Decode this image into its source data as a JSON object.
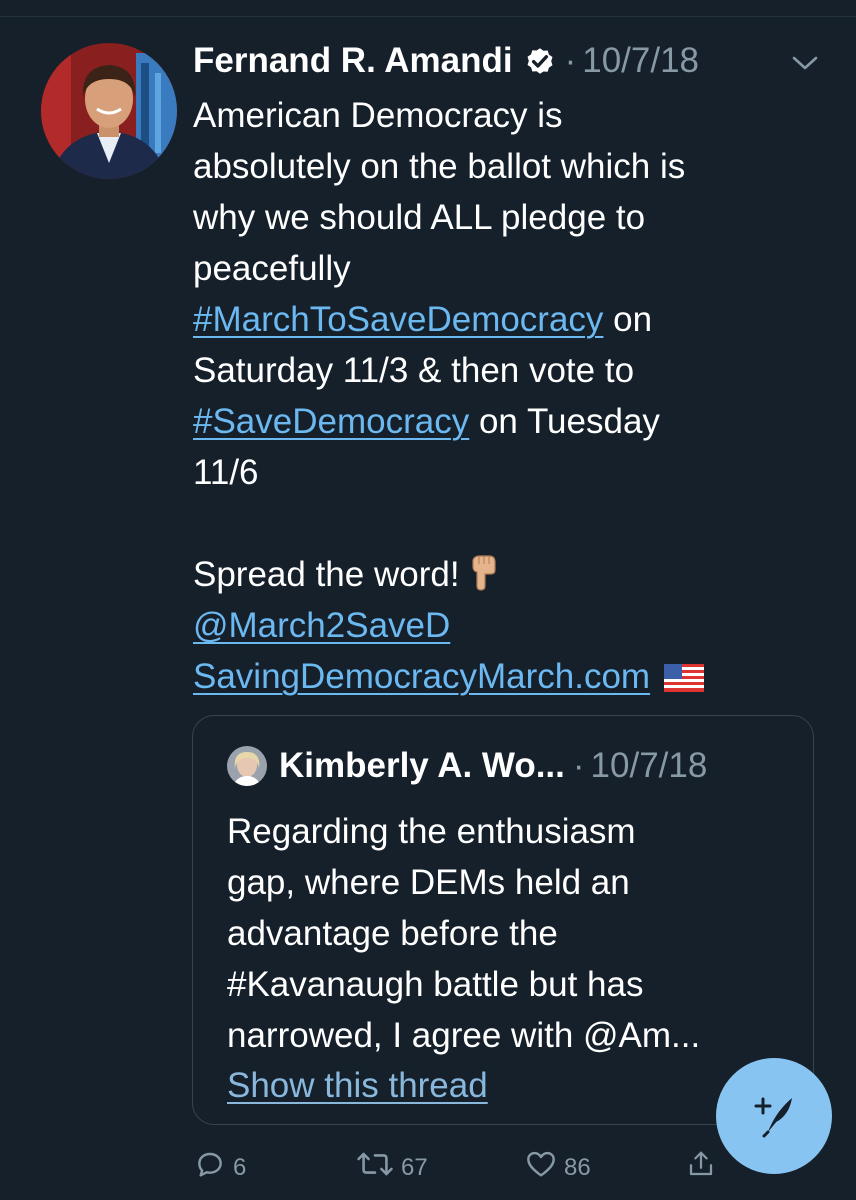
{
  "tweet": {
    "author_name": "Fernand R. Amandi",
    "separator": "·",
    "date": "10/7/18",
    "body_lines": [
      [
        {
          "t": "American Democracy is"
        }
      ],
      [
        {
          "t": "absolutely on the ballot which is"
        }
      ],
      [
        {
          "t": "why we should ALL pledge to"
        }
      ],
      [
        {
          "t": "peacefully"
        }
      ],
      [
        {
          "t": "#MarchToSaveDemocracy",
          "link": true
        },
        {
          "t": " on"
        }
      ],
      [
        {
          "t": "Saturday 11/3 & then vote to"
        }
      ],
      [
        {
          "t": "#SaveDemocracy",
          "link": true
        },
        {
          "t": " on Tuesday"
        }
      ],
      [
        {
          "t": "11/6"
        }
      ],
      [
        {
          "t": ""
        }
      ],
      [
        {
          "t": "Spread the word! "
        },
        {
          "emoji": "pointing-down"
        }
      ],
      [
        {
          "t": "@March2SaveD",
          "link": true
        }
      ],
      [
        {
          "t": "SavingDemocracyMarch.com",
          "link": true
        },
        {
          "emoji": "us-flag"
        }
      ]
    ]
  },
  "quote": {
    "author_name": "Kimberly A. Wo...",
    "separator": "·",
    "date": "10/7/18",
    "body_lines": [
      "Regarding the enthusiasm",
      "gap, where DEMs held an",
      "advantage before the",
      "#Kavanaugh battle but has",
      "narrowed, I agree with @Am..."
    ],
    "show_thread": "Show this thread"
  },
  "actions": {
    "reply_count": "6",
    "retweet_count": "67",
    "like_count": "86"
  },
  "icons": {
    "verified": "verified-badge-icon",
    "menu": "chevron-down-icon",
    "reply": "reply-icon",
    "retweet": "retweet-icon",
    "like": "heart-icon",
    "share": "share-icon",
    "compose": "compose-tweet-icon"
  },
  "colors": {
    "background": "#15202b",
    "link": "#6cb8f0",
    "secondary_text": "#8899a6",
    "fab": "#88c4f2"
  }
}
